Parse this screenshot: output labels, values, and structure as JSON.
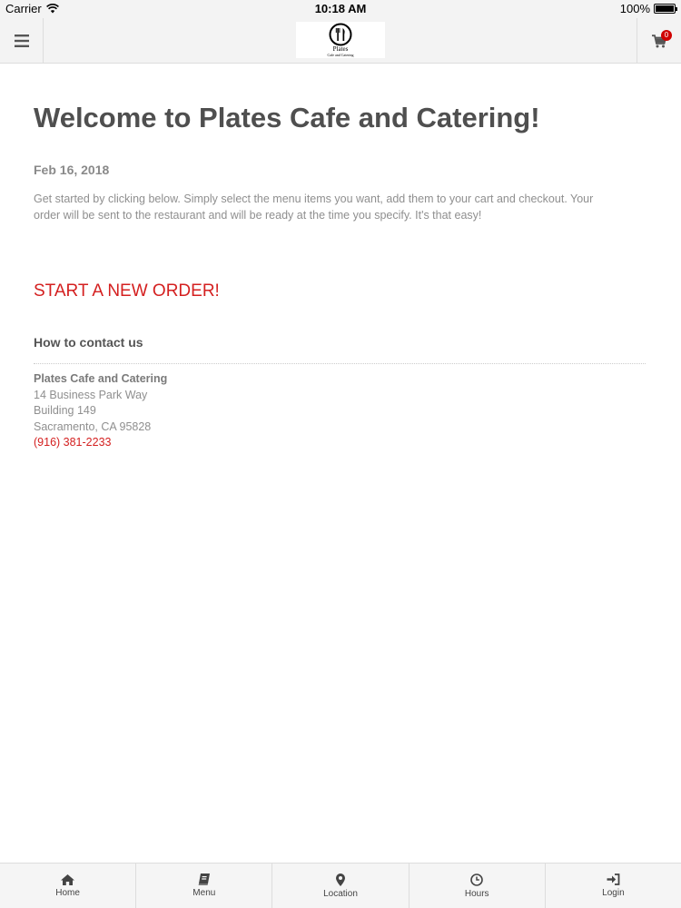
{
  "status_bar": {
    "carrier": "Carrier",
    "time": "10:18 AM",
    "battery": "100%"
  },
  "header": {
    "logo": {
      "name": "Plates",
      "tagline": "Cafe and Catering"
    },
    "cart_count": "0"
  },
  "main": {
    "title": "Welcome to Plates Cafe and Catering!",
    "date": "Feb 16, 2018",
    "intro_line1": "Get started by clicking below. Simply select the menu items you want, add them to your cart and checkout. Your",
    "intro_line2": "order will be sent to the restaurant and will be ready at the time you specify. It's that easy!",
    "start_order": "START A NEW ORDER!",
    "contact_heading": "How to contact us",
    "contact": {
      "name": "Plates Cafe and Catering",
      "address1": "14 Business Park Way",
      "address2": "Building 149",
      "city_state_zip": "Sacramento, CA 95828",
      "phone": "(916) 381-2233"
    }
  },
  "tabs": [
    {
      "label": "Home",
      "icon": "home-icon"
    },
    {
      "label": "Menu",
      "icon": "book-icon"
    },
    {
      "label": "Location",
      "icon": "map-pin-icon"
    },
    {
      "label": "Hours",
      "icon": "clock-icon"
    },
    {
      "label": "Login",
      "icon": "login-icon"
    }
  ],
  "colors": {
    "accent": "#d42020",
    "badge": "#d00000",
    "bar_background": "#f3f3f3"
  }
}
